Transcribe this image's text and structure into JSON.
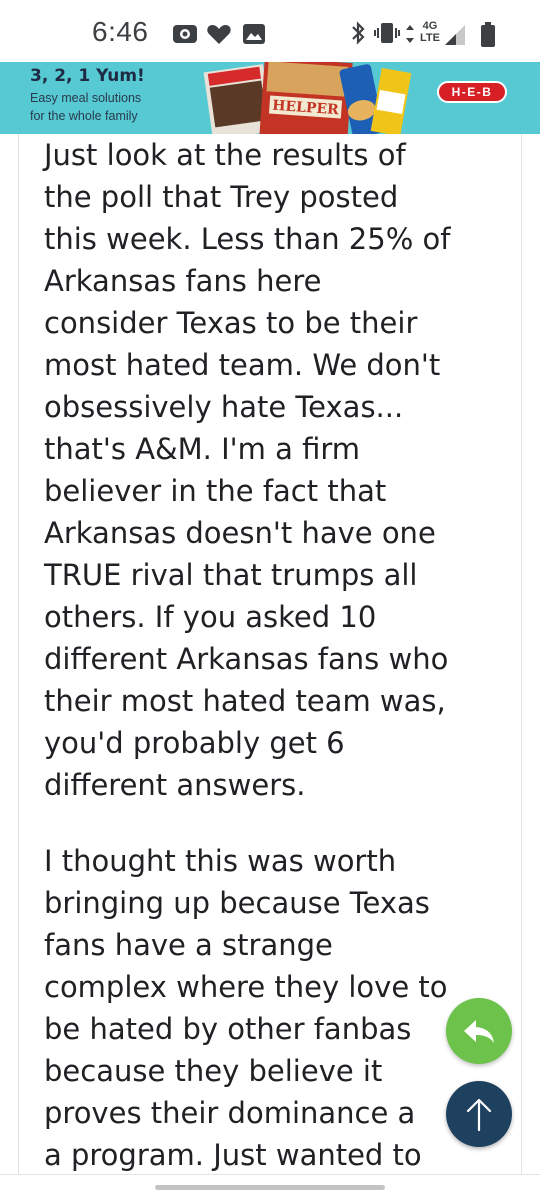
{
  "status_bar": {
    "time": "6:46",
    "network_label": "4G LTE",
    "icons": [
      "radio-icon",
      "heart-icon",
      "image-icon",
      "bluetooth-icon",
      "vibrate-icon",
      "data-arrows-icon",
      "signal-icon",
      "battery-icon"
    ]
  },
  "ad": {
    "title": "3, 2, 1 Yum!",
    "subtitle_line1": "Easy meal solutions",
    "subtitle_line2": "for the whole family",
    "product_label": "HELPER",
    "brand": "H-E-B",
    "colors": {
      "background": "#56c9d2",
      "brand_red": "#d71f26"
    }
  },
  "post": {
    "paragraph1": [
      "Just look at the results of",
      "the poll that Trey posted",
      "this week. Less than 25% of",
      "Arkansas fans here",
      "consider Texas to be their",
      "most hated team. We don't",
      "obsessively hate Texas...",
      "that's A&M. I'm a firm",
      "believer in the fact that",
      "Arkansas doesn't have one",
      "TRUE rival that trumps all",
      "others. If you asked 10",
      "different Arkansas fans who",
      "their most hated team was,",
      "you'd probably get 6",
      "different answers."
    ],
    "paragraph2": [
      "I thought this was worth",
      "bringing up because Texas",
      "fans have a strange",
      "complex where they love to",
      "be hated by other fanbas",
      "because they believe it",
      "proves their dominance a",
      "a program. Just wanted to"
    ]
  },
  "buttons": {
    "reply_icon": "reply-icon",
    "scroll_top_icon": "arrow-up-icon",
    "colors": {
      "reply": "#6cc24a",
      "scroll_top": "#1f4160"
    }
  }
}
